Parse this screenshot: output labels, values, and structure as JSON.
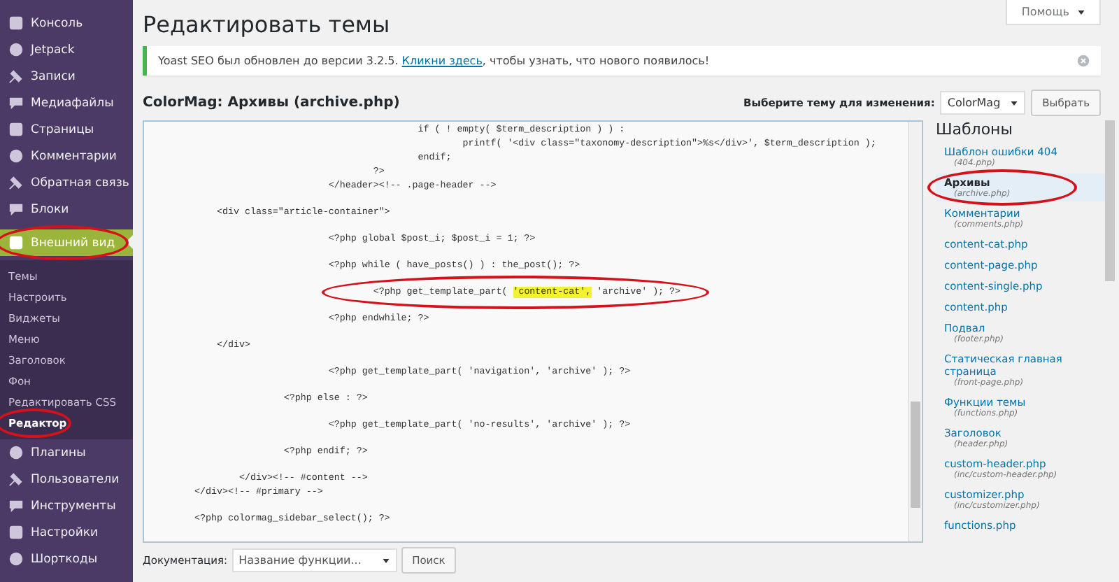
{
  "sidebar": {
    "items": [
      {
        "label": "Консоль",
        "selected": false,
        "circled": false
      },
      {
        "label": "Jetpack",
        "selected": false,
        "circled": false
      },
      {
        "label": "Записи",
        "selected": false,
        "circled": false
      },
      {
        "label": "Медиафайлы",
        "selected": false,
        "circled": false
      },
      {
        "label": "Страницы",
        "selected": false,
        "circled": false
      },
      {
        "label": "Комментарии",
        "selected": false,
        "circled": false
      },
      {
        "label": "Обратная связь",
        "selected": false,
        "circled": false
      },
      {
        "label": "Блоки",
        "selected": false,
        "circled": false
      },
      {
        "label": "Внешний вид",
        "selected": true,
        "circled": true,
        "children": [
          {
            "label": "Темы",
            "selected": false,
            "circled": false
          },
          {
            "label": "Настроить",
            "selected": false,
            "circled": false
          },
          {
            "label": "Виджеты",
            "selected": false,
            "circled": false
          },
          {
            "label": "Меню",
            "selected": false,
            "circled": false
          },
          {
            "label": "Заголовок",
            "selected": false,
            "circled": false
          },
          {
            "label": "Фон",
            "selected": false,
            "circled": false
          },
          {
            "label": "Редактировать CSS",
            "selected": false,
            "circled": false
          },
          {
            "label": "Редактор",
            "selected": true,
            "circled": true
          }
        ]
      },
      {
        "label": "Плагины",
        "selected": false,
        "circled": false
      },
      {
        "label": "Пользователи",
        "selected": false,
        "circled": false
      },
      {
        "label": "Инструменты",
        "selected": false,
        "circled": false
      },
      {
        "label": "Настройки",
        "selected": false,
        "circled": false
      },
      {
        "label": "Шорткоды",
        "selected": false,
        "circled": false
      }
    ]
  },
  "help_button": "Помощь",
  "page_title": "Редактировать темы",
  "notice": {
    "before": "Yoast SEO был обновлен до версии 3.2.5.",
    "link": "Кликни здесь",
    "after": ", чтобы узнать, что нового появилось!"
  },
  "file_heading": "ColorMag: Архивы (archive.php)",
  "theme_picker": {
    "label": "Выберите тему для изменения:",
    "value": "ColorMag",
    "button": "Выбрать"
  },
  "code_lines": [
    {
      "gap_before": false,
      "circled": false,
      "parts": [
        {
          "text": "\t\t\t\t\tif ( ! empty( $term_description ) ) :",
          "highlighted": false
        }
      ]
    },
    {
      "gap_before": false,
      "circled": false,
      "parts": [
        {
          "text": "\t\t\t\t\t\tprintf( '<div class=\"taxonomy-description\">%s</div>', $term_description );",
          "highlighted": false
        }
      ]
    },
    {
      "gap_before": false,
      "circled": false,
      "parts": [
        {
          "text": "\t\t\t\t\tendif;",
          "highlighted": false
        }
      ]
    },
    {
      "gap_before": false,
      "circled": false,
      "parts": [
        {
          "text": "\t\t\t\t?>",
          "highlighted": false
        }
      ]
    },
    {
      "gap_before": false,
      "circled": false,
      "parts": [
        {
          "text": "\t\t\t</header><!-- .page-header -->",
          "highlighted": false
        }
      ]
    },
    {
      "gap_before": true,
      "circled": false,
      "parts": [
        {
          "text": "    <div class=\"article-container\">",
          "highlighted": false
        }
      ]
    },
    {
      "gap_before": true,
      "circled": false,
      "parts": [
        {
          "text": "\t\t\t<?php global $post_i; $post_i = 1; ?>",
          "highlighted": false
        }
      ]
    },
    {
      "gap_before": true,
      "circled": false,
      "parts": [
        {
          "text": "\t\t\t<?php while ( have_posts() ) : the_post(); ?>",
          "highlighted": false
        }
      ]
    },
    {
      "gap_before": true,
      "circled": true,
      "parts": [
        {
          "text": "\t\t\t\t<?php get_template_part( ",
          "highlighted": false
        },
        {
          "text": "'content-cat',",
          "highlighted": true
        },
        {
          "text": " 'archive' ); ?>",
          "highlighted": false
        }
      ]
    },
    {
      "gap_before": true,
      "circled": false,
      "parts": [
        {
          "text": "\t\t\t<?php endwhile; ?>",
          "highlighted": false
        }
      ]
    },
    {
      "gap_before": true,
      "circled": false,
      "parts": [
        {
          "text": "    </div>",
          "highlighted": false
        }
      ]
    },
    {
      "gap_before": true,
      "circled": false,
      "parts": [
        {
          "text": "\t\t\t<?php get_template_part( 'navigation', 'archive' ); ?>",
          "highlighted": false
        }
      ]
    },
    {
      "gap_before": true,
      "circled": false,
      "parts": [
        {
          "text": "\t\t<?php else : ?>",
          "highlighted": false
        }
      ]
    },
    {
      "gap_before": true,
      "circled": false,
      "parts": [
        {
          "text": "\t\t\t<?php get_template_part( 'no-results', 'archive' ); ?>",
          "highlighted": false
        }
      ]
    },
    {
      "gap_before": true,
      "circled": false,
      "parts": [
        {
          "text": "\t\t<?php endif; ?>",
          "highlighted": false
        }
      ]
    },
    {
      "gap_before": true,
      "circled": false,
      "parts": [
        {
          "text": "\t</div><!-- #content -->",
          "highlighted": false
        }
      ]
    },
    {
      "gap_before": false,
      "circled": false,
      "parts": [
        {
          "text": "</div><!-- #primary -->",
          "highlighted": false
        }
      ]
    },
    {
      "gap_before": true,
      "circled": false,
      "parts": [
        {
          "text": "<?php colormag_sidebar_select(); ?>",
          "highlighted": false
        }
      ]
    }
  ],
  "templates": {
    "title": "Шаблоны",
    "items": [
      {
        "name": "Шаблон ошибки 404",
        "file": "(404.php)",
        "selected": false,
        "circled": false
      },
      {
        "name": "Архивы",
        "file": "(archive.php)",
        "selected": true,
        "circled": true
      },
      {
        "name": "Комментарии",
        "file": "(comments.php)",
        "selected": false,
        "circled": false
      },
      {
        "name": "content-cat.php",
        "selected": false,
        "circled": false
      },
      {
        "name": "content-page.php",
        "selected": false,
        "circled": false
      },
      {
        "name": "content-single.php",
        "selected": false,
        "circled": false
      },
      {
        "name": "content.php",
        "selected": false,
        "circled": false
      },
      {
        "name": "Подвал",
        "file": "(footer.php)",
        "selected": false,
        "circled": false
      },
      {
        "name": "Статическая главная страница",
        "file": "(front-page.php)",
        "selected": false,
        "circled": false
      },
      {
        "name": "Функции темы",
        "file": "(functions.php)",
        "selected": false,
        "circled": false
      },
      {
        "name": "Заголовок",
        "file": "(header.php)",
        "selected": false,
        "circled": false
      },
      {
        "name": "custom-header.php",
        "file": "(inc/custom-header.php)",
        "selected": false,
        "circled": false
      },
      {
        "name": "customizer.php",
        "file": "(inc/customizer.php)",
        "selected": false,
        "circled": false
      },
      {
        "name": "functions.php",
        "selected": false,
        "circled": false
      }
    ]
  },
  "documentation": {
    "label": "Документация:",
    "placeholder": "Название функции...",
    "button": "Поиск"
  }
}
